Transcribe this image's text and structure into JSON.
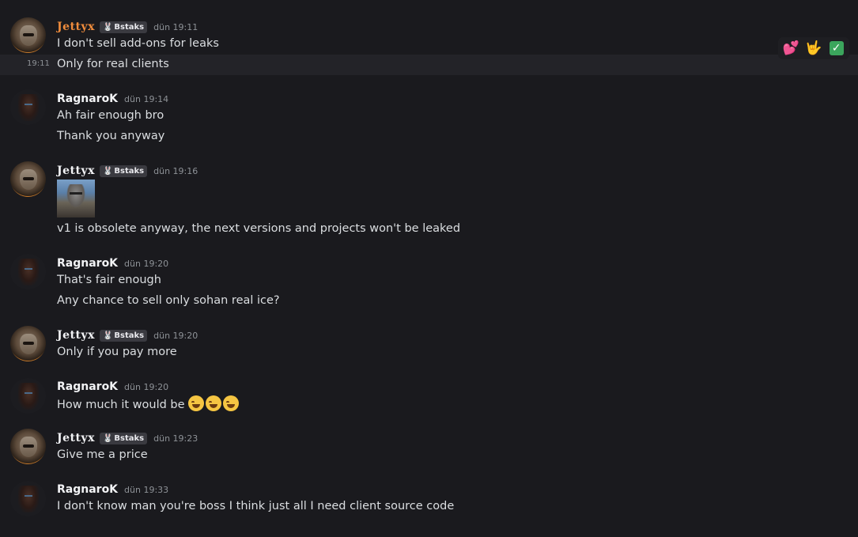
{
  "messages": [
    {
      "author": "Jettyx",
      "tag": "Bstaks",
      "time": "dün 19:11",
      "lines": [
        "I don't sell add-ons for leaks"
      ]
    },
    {
      "side_time": "19:11",
      "line": "Only for real clients"
    },
    {
      "author": "RagnaroK",
      "time": "dün 19:14",
      "lines": [
        "Ah fair enough bro",
        "Thank you anyway"
      ]
    },
    {
      "author": "Jettyx",
      "tag": "Bstaks",
      "time": "dün 19:16",
      "lines": [
        "v1 is obsolete anyway, the next versions and projects won't be leaked"
      ]
    },
    {
      "author": "RagnaroK",
      "time": "dün 19:20",
      "lines": [
        "That's fair enough",
        "Any chance to sell only sohan real ice?"
      ]
    },
    {
      "author": "Jettyx",
      "tag": "Bstaks",
      "time": "dün 19:20",
      "lines": [
        "Only if you pay more"
      ]
    },
    {
      "author": "RagnaroK",
      "time": "dün 19:20",
      "lines": [
        "How much it would be"
      ]
    },
    {
      "author": "Jettyx",
      "tag": "Bstaks",
      "time": "dün 19:23",
      "lines": [
        "Give me a price"
      ]
    },
    {
      "author": "RagnaroK",
      "time": "dün 19:33",
      "lines": [
        "I don't know man you're boss I think just all I need client source code"
      ]
    }
  ],
  "reactions": [
    {
      "icon": "heart-icon",
      "glyph": "💕"
    },
    {
      "icon": "rock-hand-icon",
      "glyph": "🤟"
    },
    {
      "icon": "check-icon",
      "glyph": "✓"
    }
  ],
  "emoji_count": 3,
  "tag_glyph": "🐰",
  "colors": {
    "background": "#1a1a1e",
    "hover_row": "#232328",
    "jettyx_first_name": "#f08c3c"
  }
}
